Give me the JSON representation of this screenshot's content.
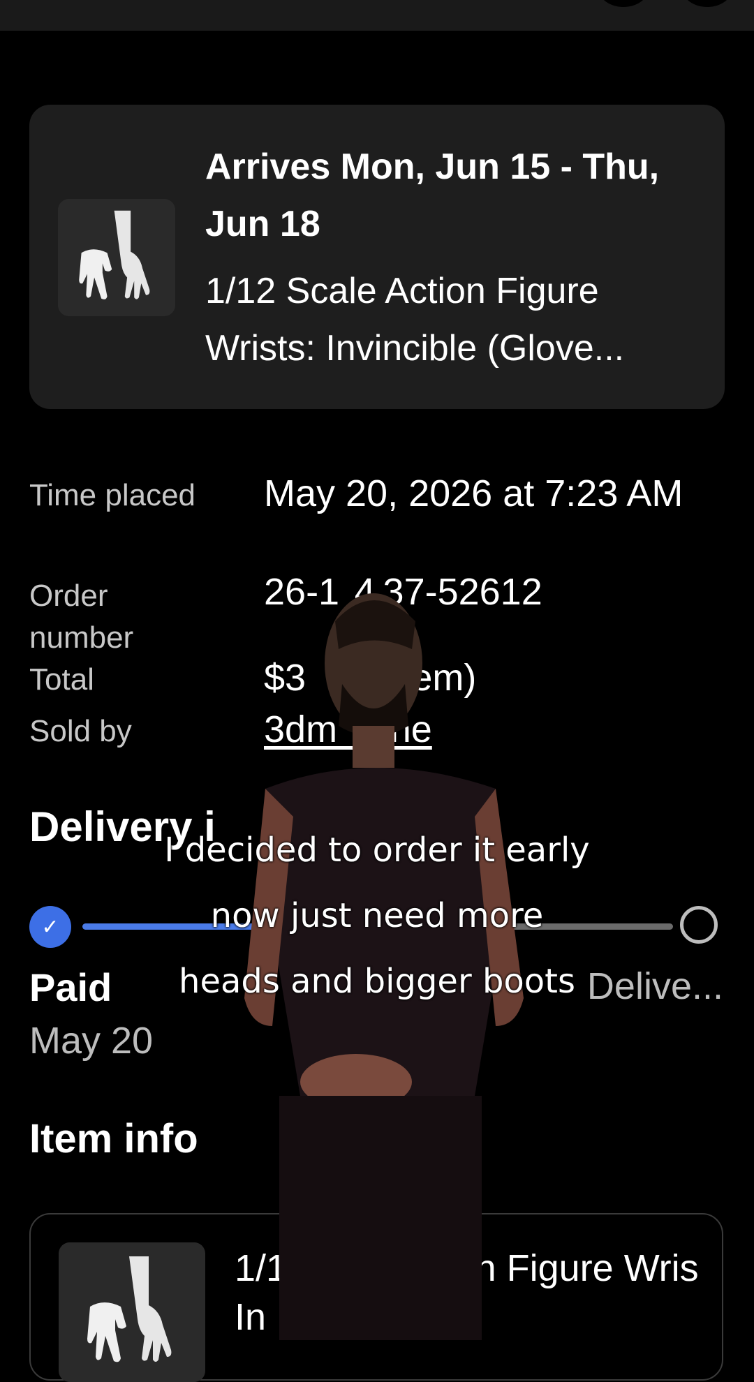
{
  "order": {
    "arrives": "Arrives Mon, Jun 15 - Thu, Jun 18",
    "item_title": "1/12 Scale Action Figure Wrists: Invincible (Glove..."
  },
  "details": {
    "time_placed_label": "Time placed",
    "time_placed_value": "May 20, 2026 at 7:23 AM",
    "order_number_label": "Order number",
    "order_number_value": "26-1  4 37-52612",
    "total_label": "Total",
    "total_value": "$3         l item)",
    "sold_by_label": "Sold by",
    "sold_by_value": "3dm       ne"
  },
  "delivery": {
    "section_title": "Delivery i",
    "paid_label": "Paid",
    "paid_date": "May 20",
    "delivered_label": "Delive..."
  },
  "item_info": {
    "section_title": "Item info",
    "card_title": "1/12  al   tion Figure Wris  In  ible"
  },
  "captions": [
    "I decided to order it early",
    "now just need more",
    "heads and bigger boots"
  ],
  "colors": {
    "accent_blue": "#4a7be8",
    "card_bg": "#1e1e1e",
    "track_gray": "#6b6b6b"
  },
  "icons": {
    "check": "checkmark-icon",
    "pending": "empty-circle-icon"
  }
}
